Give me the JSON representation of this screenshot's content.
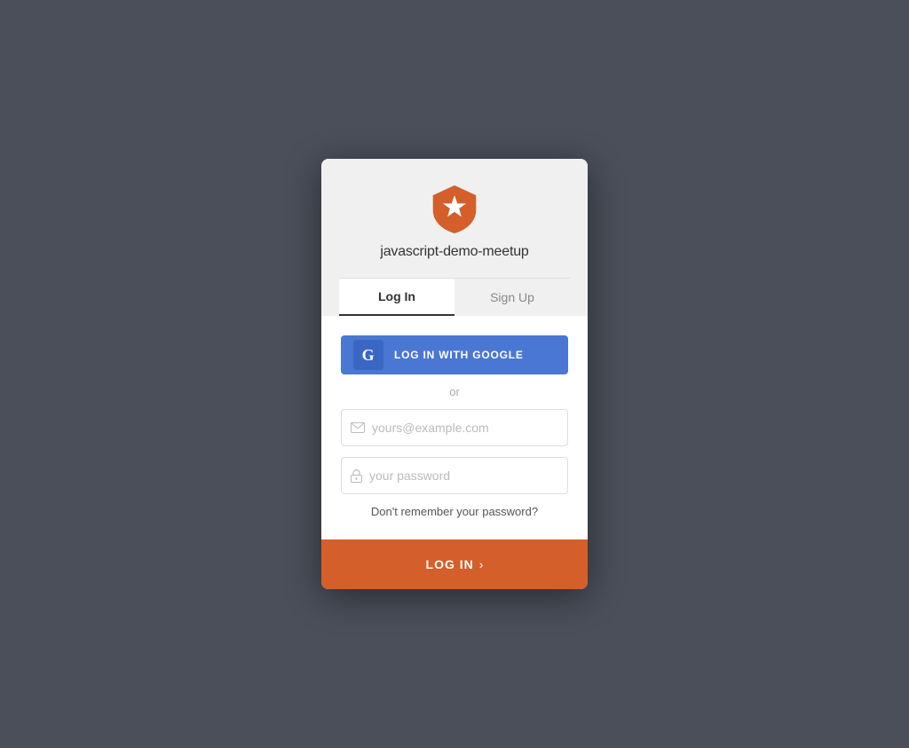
{
  "app": {
    "name": "javascript-demo-meetup",
    "background_color": "#4a4f5a",
    "accent_color": "#d45f2a",
    "google_btn_color": "#4a77d4"
  },
  "tabs": {
    "login": {
      "label": "Log In",
      "active": true
    },
    "signup": {
      "label": "Sign Up",
      "active": false
    }
  },
  "google_button": {
    "label": "LOG IN WITH GOOGLE",
    "icon_letter": "G"
  },
  "divider": {
    "text": "or"
  },
  "email_field": {
    "placeholder": "yours@example.com",
    "value": ""
  },
  "password_field": {
    "placeholder": "your password",
    "value": ""
  },
  "forgot_password": {
    "label": "Don't remember your password?"
  },
  "login_button": {
    "label": "LOG IN",
    "chevron": "›"
  }
}
